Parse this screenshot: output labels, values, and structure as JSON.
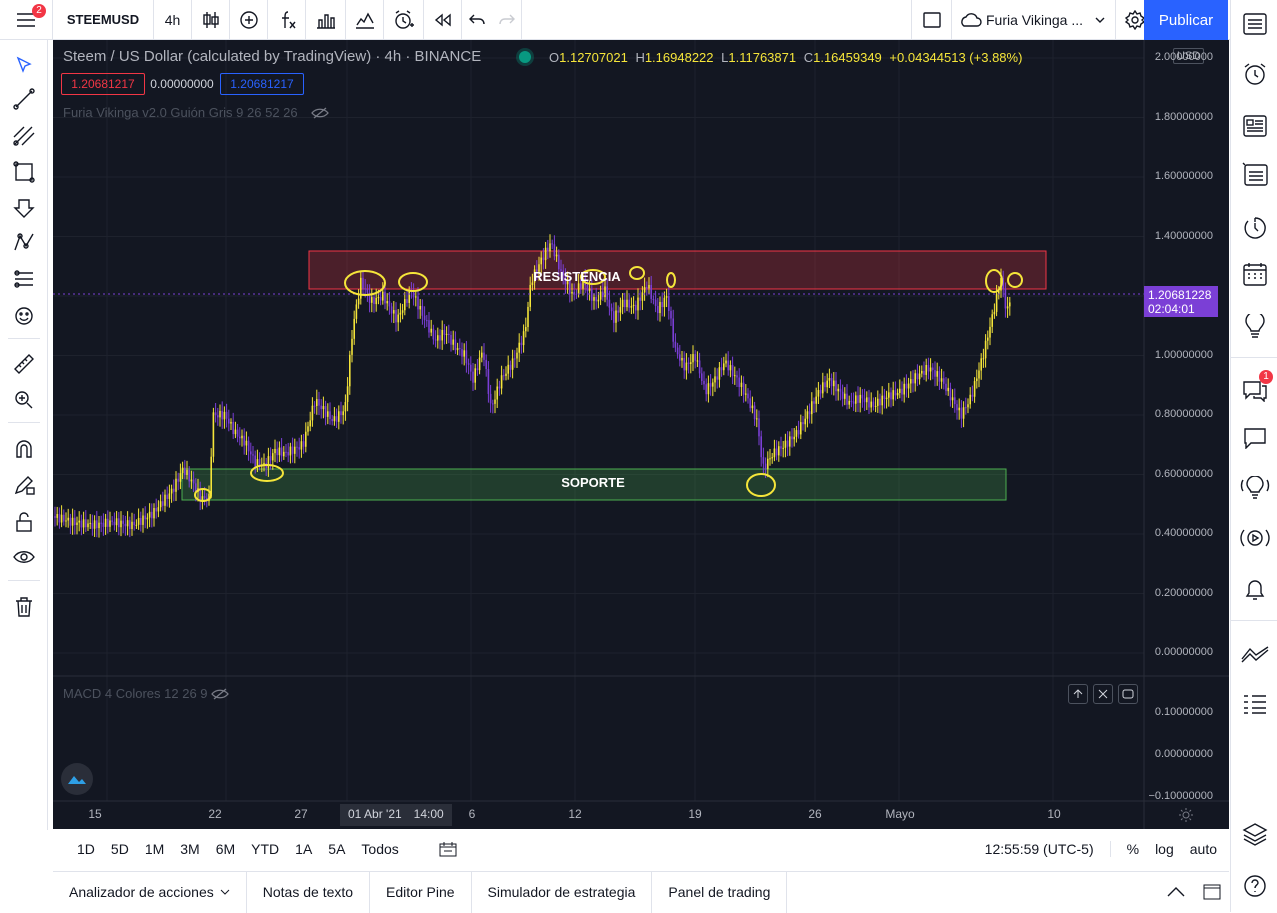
{
  "topbar": {
    "symbol": "STEEMUSD",
    "interval": "4h",
    "menu_badge": "2",
    "layout_name": "Furia Vikinga ...",
    "publish_label": "Publicar",
    "icons": [
      "menu-icon",
      "candles-icon",
      "add-icon",
      "indicators-icon",
      "templates-icon",
      "compare-icon",
      "alert-icon",
      "replay-icon",
      "undo-icon",
      "redo-icon",
      "layout-icon",
      "cloud-icon",
      "settings-icon",
      "fullscreen-icon",
      "camera-icon"
    ]
  },
  "legend": {
    "title": "Steem / US Dollar (calculated by TradingView) · 4h · BINANCE",
    "open_label": "O",
    "open": "1.12707021",
    "high_label": "H",
    "high": "1.16948222",
    "low_label": "L",
    "low": "1.11763871",
    "close_label": "C",
    "close": "1.16459349",
    "change": "+0.04344513 (+3.88%)",
    "bid": "1.20681217",
    "spread": "0.00000000",
    "ask": "1.20681217",
    "indicator": "Furia Vikinga v2.0 Guión Gris 9 26 52 26",
    "macd": "MACD 4 Colores 12 26 9"
  },
  "price_axis": {
    "currency": "USD",
    "labels": [
      "2.00000000",
      "1.80000000",
      "1.60000000",
      "1.40000000",
      "1.20000000",
      "1.00000000",
      "0.80000000",
      "0.60000000",
      "0.40000000",
      "0.20000000",
      "0.00000000"
    ],
    "current_price": "1.20681228",
    "countdown": "02:04:01",
    "macd_labels": [
      "0.10000000",
      "0.00000000",
      "−0.10000000"
    ]
  },
  "time_axis": {
    "labels": [
      "15",
      "22",
      "27",
      "6",
      "12",
      "19",
      "26",
      "Mayo",
      "10"
    ],
    "cursor_date": "01 Abr '21",
    "cursor_time": "14:00"
  },
  "annotations": {
    "resistance": "RESISTENCIA",
    "support": "SOPORTE"
  },
  "periods": [
    "1D",
    "5D",
    "1M",
    "3M",
    "6M",
    "YTD",
    "1A",
    "5A",
    "Todos"
  ],
  "status": {
    "clock": "12:55:59 (UTC-5)",
    "percent": "%",
    "log": "log",
    "auto": "auto"
  },
  "bottom_tabs": [
    "Analizador de acciones",
    "Notas de texto",
    "Editor Pine",
    "Simulador de estrategia",
    "Panel de trading"
  ],
  "right_badge": "1",
  "chart_data": {
    "type": "candlestick",
    "symbol": "STEEMUSD",
    "x": [
      "15",
      "22",
      "27",
      "01 Abr '21",
      "6",
      "12",
      "19",
      "26",
      "Mayo",
      "10"
    ],
    "close": [
      0.44,
      0.75,
      0.78,
      1.18,
      0.88,
      1.22,
      0.95,
      0.6,
      0.92,
      0.88,
      1.21
    ],
    "resistance_zone": [
      1.22,
      1.35
    ],
    "support_zone": [
      0.52,
      0.62
    ],
    "ylim": [
      0,
      2.0
    ],
    "colors": {
      "up": "#f5e53a",
      "down": "#7b3fd6",
      "resistance": "#f23645",
      "support": "#4caf50"
    }
  }
}
